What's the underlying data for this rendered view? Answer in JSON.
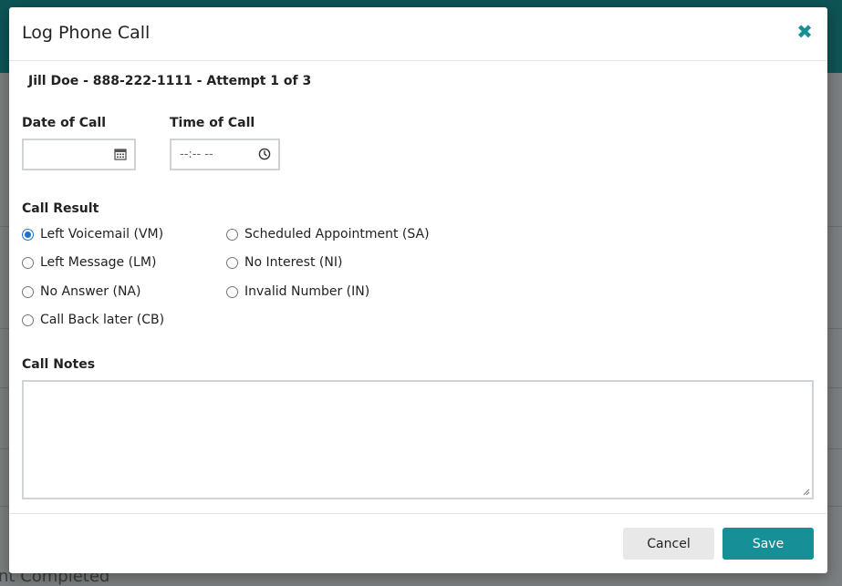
{
  "modal": {
    "title": "Log Phone Call",
    "close_icon": "close-icon",
    "contact_line": "Jill Doe - 888-222-1111 - Attempt 1 of 3"
  },
  "date_field": {
    "label": "Date of Call",
    "value": "",
    "icon": "calendar-icon"
  },
  "time_field": {
    "label": "Time of Call",
    "value": "--:-- --",
    "icon": "clock-icon"
  },
  "call_result": {
    "label": "Call Result",
    "selected": "Left Voicemail (VM)",
    "options": [
      "Left Voicemail (VM)",
      "Left Message (LM)",
      "No Answer (NA)",
      "Call Back later (CB)",
      "Scheduled Appointment (SA)",
      "No Interest (NI)",
      "Invalid Number (IN)"
    ]
  },
  "notes": {
    "label": "Call Notes",
    "value": ""
  },
  "footer": {
    "cancel_label": "Cancel",
    "save_label": "Save"
  },
  "background": {
    "partial_text_bottom": "nt Completed"
  },
  "colors": {
    "accent": "#178f97",
    "header_bg": "#0e5456",
    "radio_checked": "#1a73c8"
  }
}
